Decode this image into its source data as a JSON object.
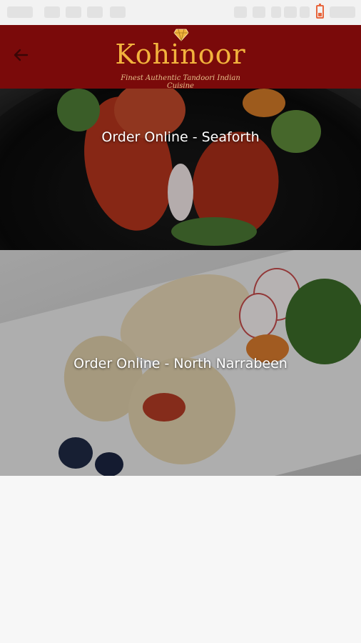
{
  "header": {
    "brand": "Kohinoor",
    "tagline": "Finest Authentic Tandoori Indian Cuisine",
    "back_icon": "arrow-left-icon",
    "bar_color": "#7a0a0a",
    "brand_color": "#f2b33d"
  },
  "banners": [
    {
      "label": "Order Online - Seaforth"
    },
    {
      "label": "Order Online - North Narrabeen"
    }
  ]
}
